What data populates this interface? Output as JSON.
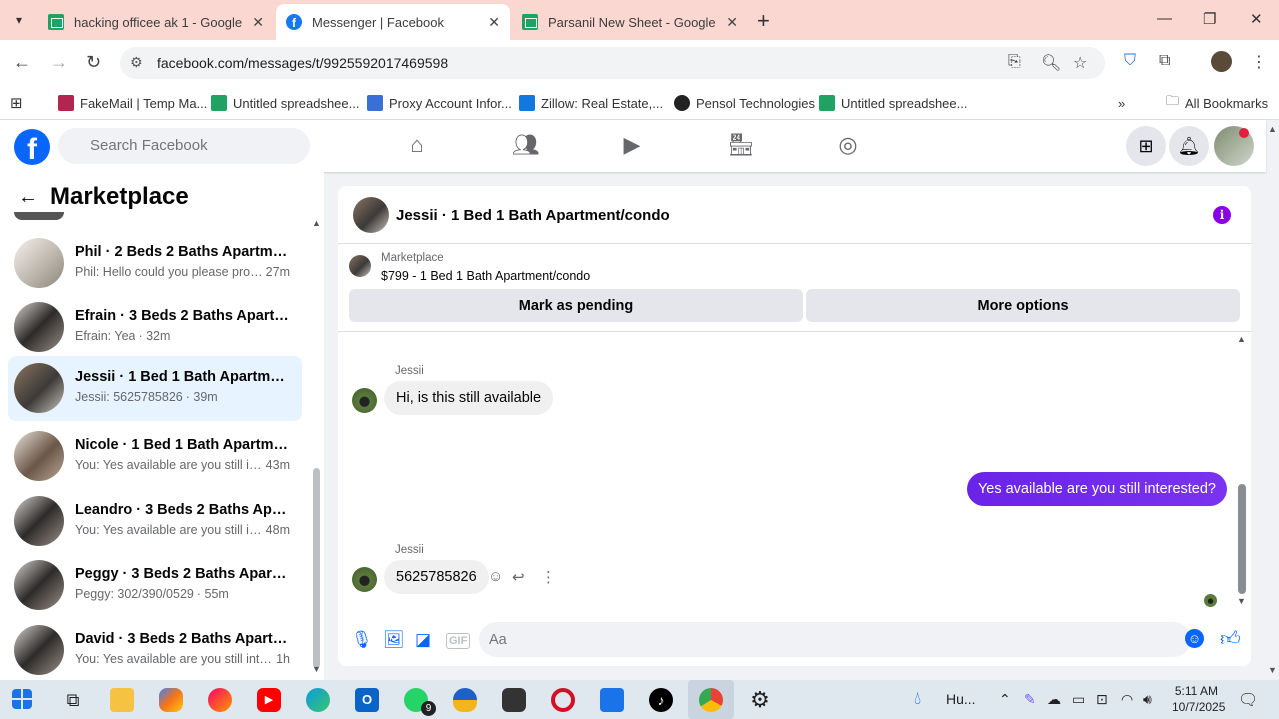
{
  "browser": {
    "tabs": [
      {
        "title": "hacking officee ak 1 - Google Sl",
        "favicon": "sheets-icon",
        "active": false
      },
      {
        "title": "Messenger | Facebook",
        "favicon": "facebook-icon",
        "active": true
      },
      {
        "title": "Parsanil New Sheet - Google Dr",
        "favicon": "sheets-icon",
        "active": false
      }
    ],
    "url": "facebook.com/messages/t/9925592017469598",
    "bookmarks": [
      {
        "label": "FakeMail | Temp Ma...",
        "color": "#b3244e"
      },
      {
        "label": "Untitled spreadshee...",
        "color": "#1ea362"
      },
      {
        "label": "Proxy Account Infor...",
        "color": "#3b6fd8"
      },
      {
        "label": "Zillow: Real Estate,...",
        "color": "#1277e1"
      },
      {
        "label": "Pensol Technologies",
        "color": "#222222"
      },
      {
        "label": "Untitled spreadshee...",
        "color": "#1ea362"
      }
    ],
    "all_bookmarks": "All Bookmarks"
  },
  "facebook": {
    "search_placeholder": "Search Facebook",
    "logo": "f"
  },
  "sidebar": {
    "title": "Marketplace",
    "conversations": [
      {
        "name": "Phil · 2 Beds 2 Baths Apartment...",
        "preview": "Phil: Hello could you please provi...",
        "time": "27m",
        "selected": false
      },
      {
        "name": "Efrain · 3 Beds 2 Baths Apartme...",
        "preview": "Efrain: Yea",
        "time": "· 32m",
        "selected": false
      },
      {
        "name": "Jessii · 1 Bed 1 Bath Apartment/c...",
        "preview": "Jessii: 5625785826",
        "time": "· 39m",
        "selected": true
      },
      {
        "name": "Nicole · 1 Bed 1 Bath Apartment...",
        "preview": "You: Yes available are you still int...",
        "time": "43m",
        "selected": false
      },
      {
        "name": "Leandro · 3 Beds 2 Baths Apart...",
        "preview": "You: Yes available are you still int...",
        "time": "48m",
        "selected": false
      },
      {
        "name": "Peggy · 3 Beds 2 Baths Apartme...",
        "preview": "Peggy: 302/390/0529",
        "time": "· 55m",
        "selected": false
      },
      {
        "name": "David · 3 Beds 2 Baths Apartme...",
        "preview": "You: Yes available are you still inter...",
        "time": "1h",
        "selected": false
      }
    ]
  },
  "chat": {
    "title": "Jessii · 1 Bed 1 Bath Apartment/condo",
    "marketplace_label": "Marketplace",
    "listing": "$799 - 1 Bed 1 Bath Apartment/condo",
    "mark_pending": "Mark as pending",
    "more_options": "More options",
    "messages": [
      {
        "sender": "Jessii",
        "text": "Hi, is this still available",
        "direction": "in"
      },
      {
        "text": "Yes available are you still  interested?",
        "direction": "out"
      },
      {
        "sender": "Jessii",
        "text": "5625785826",
        "direction": "in"
      }
    ],
    "composer_placeholder": "Aa",
    "accent": "#0866ff",
    "outgoing_bubble": "#6e2ce8"
  },
  "taskbar": {
    "weather": "Hu...",
    "time": "5:11 AM",
    "date": "10/7/2025",
    "whatsapp_badge": "9"
  }
}
